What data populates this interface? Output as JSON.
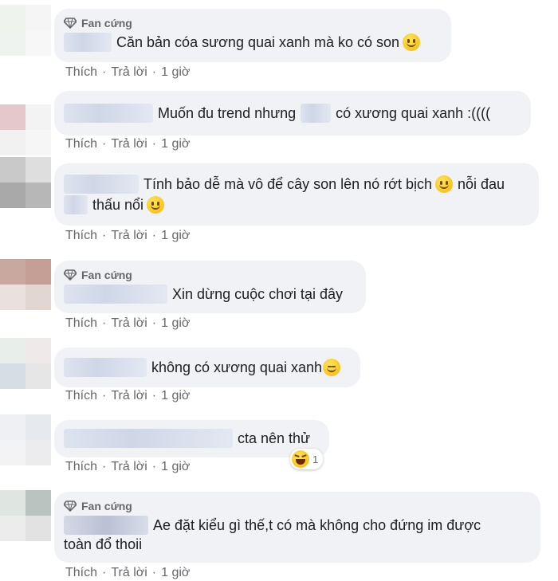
{
  "badge_label": "Fan cứng",
  "action_like": "Thích",
  "action_reply": "Trả lời",
  "separator": "·",
  "comments": [
    {
      "text": "Căn bản cóa sương quai xanh mà ko có son",
      "time": "1 giờ"
    },
    {
      "text_before": "Muốn đu trend nhưng",
      "text_after": "có xương quai xanh :((((",
      "time": "1 giờ"
    },
    {
      "line1": "Tính bảo dễ mà vô để cây son lên nó rớt bịch",
      "line1_end": "nỗi đau",
      "line2": "thấu nổi",
      "time": "1 giờ"
    },
    {
      "text": "Xin dừng cuộc chơi tại đây",
      "time": "1 giờ"
    },
    {
      "text": "không có xương quai xanh",
      "time": "1 giờ"
    },
    {
      "text": "cta nên thử",
      "time": "1 giờ",
      "reaction_count": "1"
    },
    {
      "line1": "Ae đặt kiểu gì thế,t có mà không cho đứng im được",
      "line2": "toàn đổ thoii",
      "time": "1 giờ"
    }
  ],
  "colors": {
    "bubble": "#f0f2f5",
    "meta": "#65676b",
    "text": "#1c1e21"
  },
  "icons": [
    "diamond-icon",
    "smile-emoji",
    "relieved-emoji",
    "laugh-reaction-icon"
  ]
}
